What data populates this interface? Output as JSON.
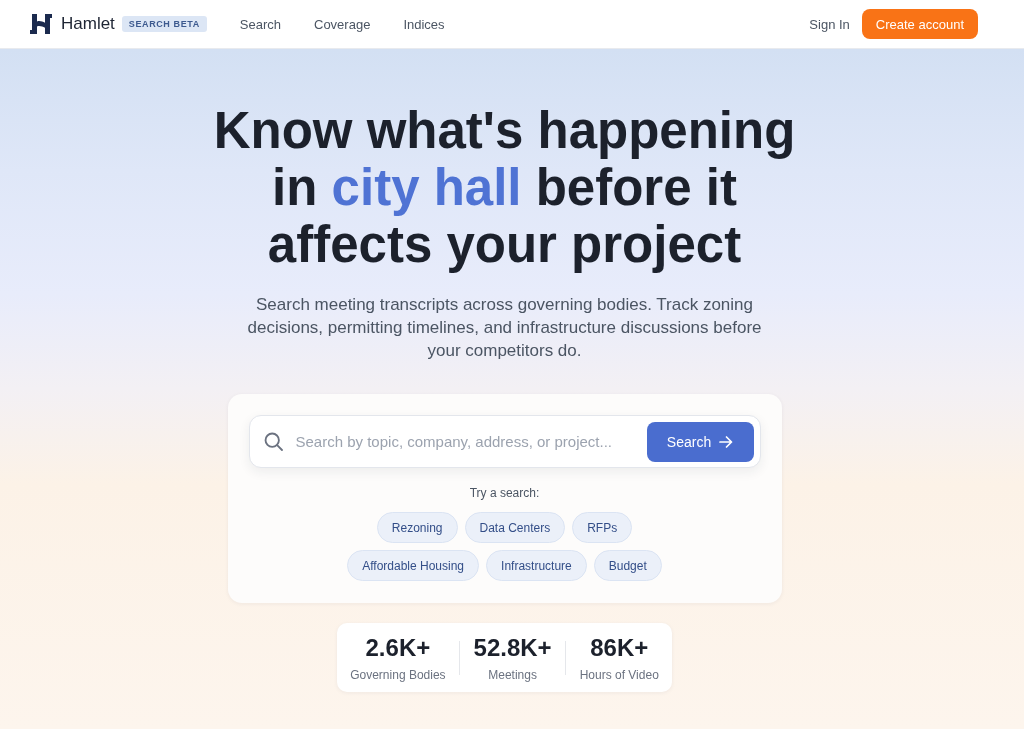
{
  "header": {
    "brand": "Hamlet",
    "badge": "SEARCH BETA",
    "nav": [
      "Search",
      "Coverage",
      "Indices"
    ],
    "sign_in": "Sign In",
    "cta": "Create account"
  },
  "hero": {
    "headline": {
      "before": "Know what's happening in",
      "highlight": "city hall",
      "after": "before it affects your project"
    },
    "subtitle": "Search meeting transcripts across governing bodies. Track zoning decisions, permitting timelines, and infrastructure discussions before your competitors do."
  },
  "search": {
    "placeholder": "Search by topic, company, address, or project...",
    "button": "Search",
    "suggestions_label": "Try a search:",
    "suggestions": [
      "Rezoning",
      "Data Centers",
      "RFPs",
      "Affordable Housing",
      "Infrastructure",
      "Budget"
    ]
  },
  "stats": [
    {
      "value": "2.6K+",
      "label": "Governing Bodies"
    },
    {
      "value": "52.8K+",
      "label": "Meetings"
    },
    {
      "value": "86K+",
      "label": "Hours of Video"
    }
  ]
}
